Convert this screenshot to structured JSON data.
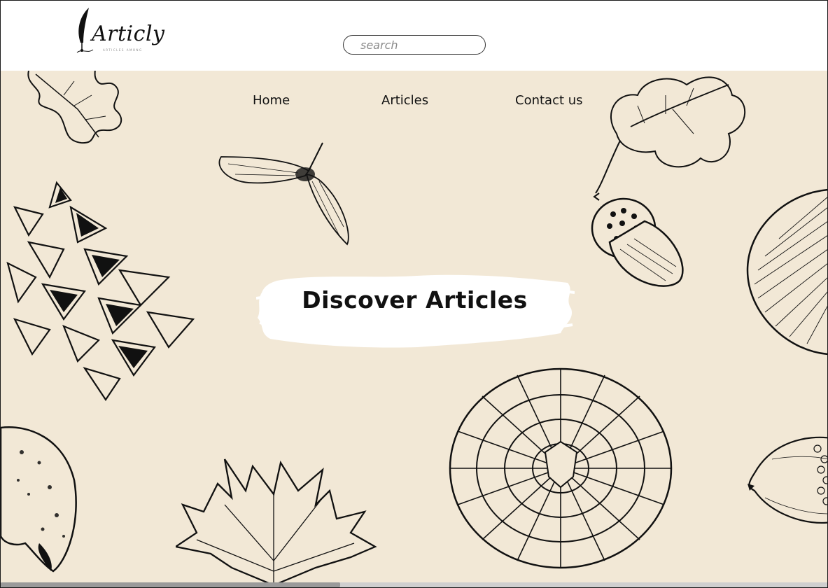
{
  "header": {
    "logo_text": "Articly",
    "logo_tagline": "ARTICLES AMONG",
    "search_placeholder": "search"
  },
  "nav": {
    "items": [
      {
        "label": "Home"
      },
      {
        "label": "Articles"
      },
      {
        "label": "Contact us"
      }
    ]
  },
  "hero": {
    "title": "Discover Articles"
  },
  "decorations": {
    "icons": [
      "oak-leaf-icon",
      "maple-seed-icon",
      "pinecone-icon",
      "acorn-icon",
      "mushroom-icon",
      "walnut-shell-icon",
      "maple-leaf-icon",
      "pinecone-top-icon",
      "small-acorn-icon"
    ]
  },
  "colors": {
    "background": "#f2e8d6",
    "header": "#ffffff",
    "ink": "#111111"
  }
}
